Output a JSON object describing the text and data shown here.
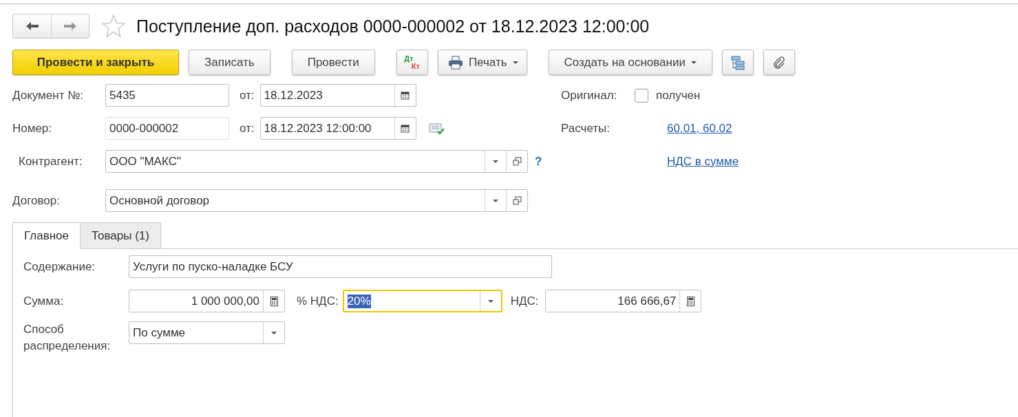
{
  "title": "Поступление доп. расходов 0000-000002 от 18.12.2023 12:00:00",
  "favorite": false,
  "toolbar": [
    [
      {
        "kind": "primary",
        "label": "Провести и закрыть"
      },
      {
        "kind": "text",
        "label": "Записать"
      }
    ],
    [
      {
        "kind": "text",
        "label": "Провести"
      }
    ],
    [
      {
        "kind": "dtkt",
        "top": "Дт",
        "bottom": "Кт"
      },
      {
        "kind": "print-menu",
        "label": "Печать"
      }
    ],
    [
      {
        "kind": "menu",
        "label": "Создать на основании"
      },
      {
        "kind": "structure"
      },
      {
        "kind": "attach"
      }
    ]
  ],
  "document_number": {
    "label": "Документ №:",
    "value": "5435",
    "date_label": "от:",
    "date": "18.12.2023"
  },
  "number": {
    "label": "Номер:",
    "value": "0000-000002",
    "date_label": "от:",
    "date": "18.12.2023 12:00:00"
  },
  "original": {
    "label": "Оригинал:",
    "checkbox_label": "получен",
    "checked": false
  },
  "settlements": {
    "label": "Расчеты:",
    "link": "60.01, 60.02"
  },
  "counterparty": {
    "label": "Контрагент:",
    "value": "ООО \"МАКС\"",
    "help": "?"
  },
  "vat_link": "НДС в сумме",
  "contract": {
    "label": "Договор:",
    "value": "Основной договор"
  },
  "tabs": [
    {
      "label": "Главное",
      "selected": true
    },
    {
      "label": "Товары (1)",
      "selected": false
    }
  ],
  "content": {
    "label": "Содержание:",
    "value": "Услуги по пуско-наладке БСУ"
  },
  "amount": {
    "label": "Сумма:",
    "value": "1 000 000,00"
  },
  "vat_rate": {
    "label": "% НДС:",
    "value": "20%",
    "focused": true
  },
  "vat": {
    "label": "НДС:",
    "value": "166 666,67"
  },
  "distribution": {
    "label": "Способ распределения:",
    "value": "По сумме"
  }
}
